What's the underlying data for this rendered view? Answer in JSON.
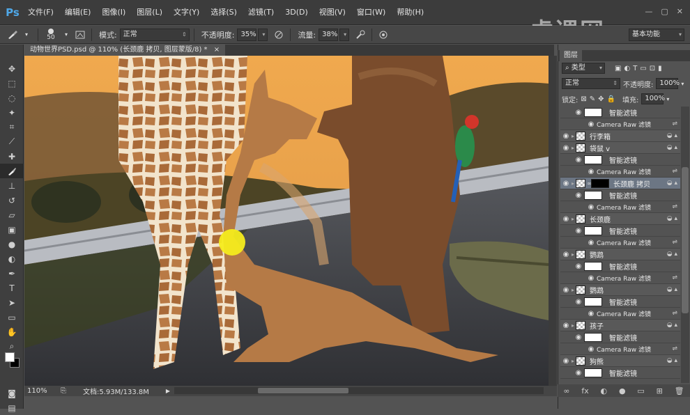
{
  "app": {
    "logo": "Ps"
  },
  "menu": [
    "文件(F)",
    "编辑(E)",
    "图像(I)",
    "图层(L)",
    "文字(Y)",
    "选择(S)",
    "滤镜(T)",
    "3D(D)",
    "视图(V)",
    "窗口(W)",
    "帮助(H)"
  ],
  "window_controls": [
    "—",
    "▢",
    "✕"
  ],
  "watermark": "虎课网",
  "options": {
    "brush_size": "50",
    "mode_label": "模式:",
    "mode_value": "正常",
    "opacity_label": "不透明度:",
    "opacity_value": "35%",
    "flow_label": "流量:",
    "flow_value": "38%",
    "workspace": "基本功能"
  },
  "document": {
    "tab_title": "动物世界PSD.psd @ 110% (长颈鹿 拷贝, 图层蒙版/8) *",
    "close": "×",
    "zoom": "110%",
    "doc_size": "文档:5.93M/133.8M"
  },
  "layers_panel": {
    "tab": "图层",
    "filter_kind": "类型",
    "blend_mode": "正常",
    "opacity_label": "不透明度:",
    "opacity_value": "100%",
    "lock_label": "锁定:",
    "fill_label": "填充:",
    "fill_value": "100%",
    "layers": [
      {
        "kind": "smart",
        "name": "智能滤镜"
      },
      {
        "kind": "sub",
        "name": "Camera Raw 滤镜"
      },
      {
        "kind": "main",
        "name": "行李箱"
      },
      {
        "kind": "main",
        "name": "袋鼠 v"
      },
      {
        "kind": "smart",
        "name": "智能滤镜"
      },
      {
        "kind": "sub",
        "name": "Camera Raw 滤镜"
      },
      {
        "kind": "selected",
        "name": "长颈鹿 拷贝"
      },
      {
        "kind": "smart",
        "name": "智能滤镜"
      },
      {
        "kind": "sub",
        "name": "Camera Raw 滤镜"
      },
      {
        "kind": "main",
        "name": "长颈鹿"
      },
      {
        "kind": "smart",
        "name": "智能滤镜"
      },
      {
        "kind": "sub",
        "name": "Camera Raw 滤镜"
      },
      {
        "kind": "main",
        "name": "鹦鹉"
      },
      {
        "kind": "smart",
        "name": "智能滤镜"
      },
      {
        "kind": "sub",
        "name": "Camera Raw 滤镜"
      },
      {
        "kind": "main",
        "name": "鹦鹉"
      },
      {
        "kind": "smart",
        "name": "智能滤镜"
      },
      {
        "kind": "sub",
        "name": "Camera Raw 滤镜"
      },
      {
        "kind": "main",
        "name": "孩子"
      },
      {
        "kind": "smart",
        "name": "智能滤镜"
      },
      {
        "kind": "sub",
        "name": "Camera Raw 滤镜"
      },
      {
        "kind": "main",
        "name": "狗熊"
      },
      {
        "kind": "smart",
        "name": "智能滤镜"
      }
    ],
    "bottom_icons": [
      "∞",
      "fx",
      "◐",
      "●",
      "▭",
      "⊞",
      "🗑"
    ]
  },
  "colors": {
    "sky_top": "#f2b35a",
    "sky_bottom": "#e28a2c",
    "road": "#3d3f45",
    "giraffe": "#c9915a",
    "kangaroo": "#b57a46",
    "bear": "#7a4c2c",
    "brush_dab": "#f5ec1e"
  }
}
